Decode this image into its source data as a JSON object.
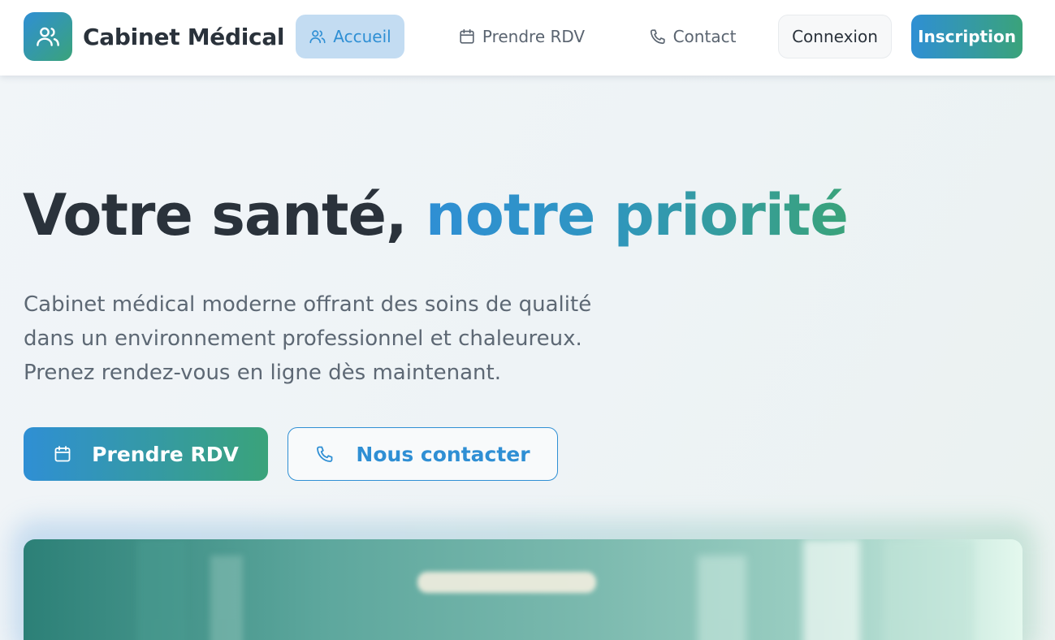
{
  "brand": {
    "name": "Cabinet Médical",
    "logo_icon": "users-icon"
  },
  "nav": {
    "items": [
      {
        "label": "Accueil",
        "icon": "users-icon",
        "active": true
      },
      {
        "label": "Prendre RDV",
        "icon": "calendar-icon",
        "active": false
      },
      {
        "label": "Contact",
        "icon": "phone-icon",
        "active": false
      }
    ],
    "login_label": "Connexion",
    "signup_label": "Inscription"
  },
  "hero": {
    "title_plain": "Votre santé, ",
    "title_accent": "notre priorité",
    "description_lines": [
      "Cabinet médical moderne offrant des soins de qualité",
      "dans un environnement professionnel et chaleureux.",
      "Prenez rendez-vous en ligne dès maintenant."
    ],
    "primary_cta": {
      "label": "Prendre RDV",
      "icon": "calendar-icon"
    },
    "secondary_cta": {
      "label": "Nous contacter",
      "icon": "phone-icon"
    }
  },
  "colors": {
    "brand_blue": "#2f8fd4",
    "brand_green": "#3aa37a",
    "active_nav_bg": "#c3dcf2",
    "text_dark": "#2a323b",
    "text_muted": "#5d6874"
  }
}
